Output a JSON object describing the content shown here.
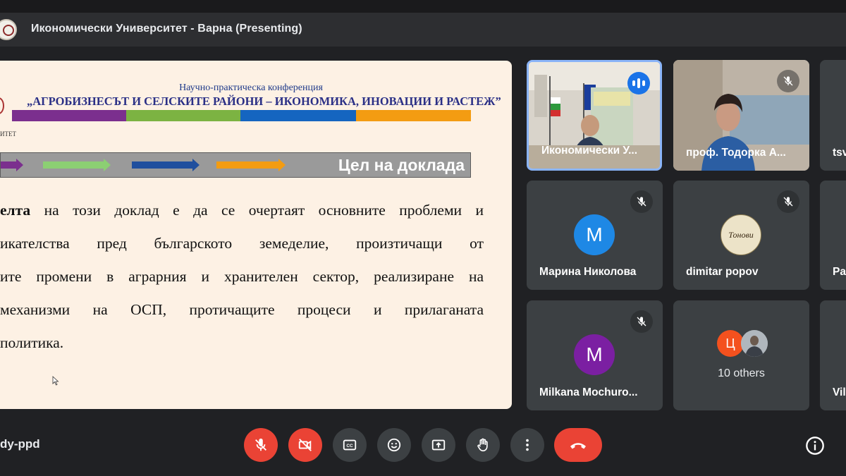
{
  "window": {
    "title": "Икономически Университет - Варна (Presenting)"
  },
  "slide": {
    "conference_line1": "Научно-практическа конференция",
    "conference_line2": "„АГРОБИЗНЕСЪТ И СЕЛСКИТЕ РАЙОНИ – ИКОНОМИКА, ИНОВАЦИИ И РАСТЕЖ”",
    "emblem_text": "ИТЕТ",
    "goal_title": "Цел на доклада",
    "body_bold": "елта",
    "body_line1_rest": " на този доклад е да се очертаят основните проблеми и",
    "body_line2": "икателства пред българското земеделие, произтичащи от",
    "body_line3": "ите промени в аграрния и хранителен сектор, реализиране на",
    "body_line4": "механизми на ОСП, протичащите процеси и прилаганата",
    "body_line5": "политика.",
    "stripe_colors": [
      "#7b2f8e",
      "#7cb342",
      "#1565c0",
      "#f39c12"
    ]
  },
  "participants": [
    {
      "name": "Икономически У...",
      "state": "speaking",
      "video": true
    },
    {
      "name": "проф. Тодорка А...",
      "state": "muted",
      "video": true
    },
    {
      "name": "tsv",
      "state": "none",
      "video": false
    },
    {
      "name": "Марина Николова",
      "state": "muted",
      "initial": "М",
      "color": "#1e88e5"
    },
    {
      "name": "dimitar popov",
      "state": "muted",
      "avatar_text": "Тонови"
    },
    {
      "name": "Pa",
      "state": "none"
    },
    {
      "name": "Milkana Mochuro...",
      "state": "muted",
      "initial": "M",
      "color": "#7b1fa2"
    },
    {
      "name": "10 others",
      "state": "none",
      "initial": "Ц",
      "color": "#f4511e"
    },
    {
      "name": "Vil",
      "state": "none"
    }
  ],
  "controls": {
    "meeting_code": "dy-ppd",
    "buttons": [
      "mic-off",
      "camera-off",
      "captions",
      "emoji",
      "present",
      "raise-hand",
      "more",
      "end-call"
    ]
  },
  "colors": {
    "accent": "#1a73e8",
    "danger": "#ea4335",
    "tile": "#3c4043",
    "background": "#202124"
  }
}
